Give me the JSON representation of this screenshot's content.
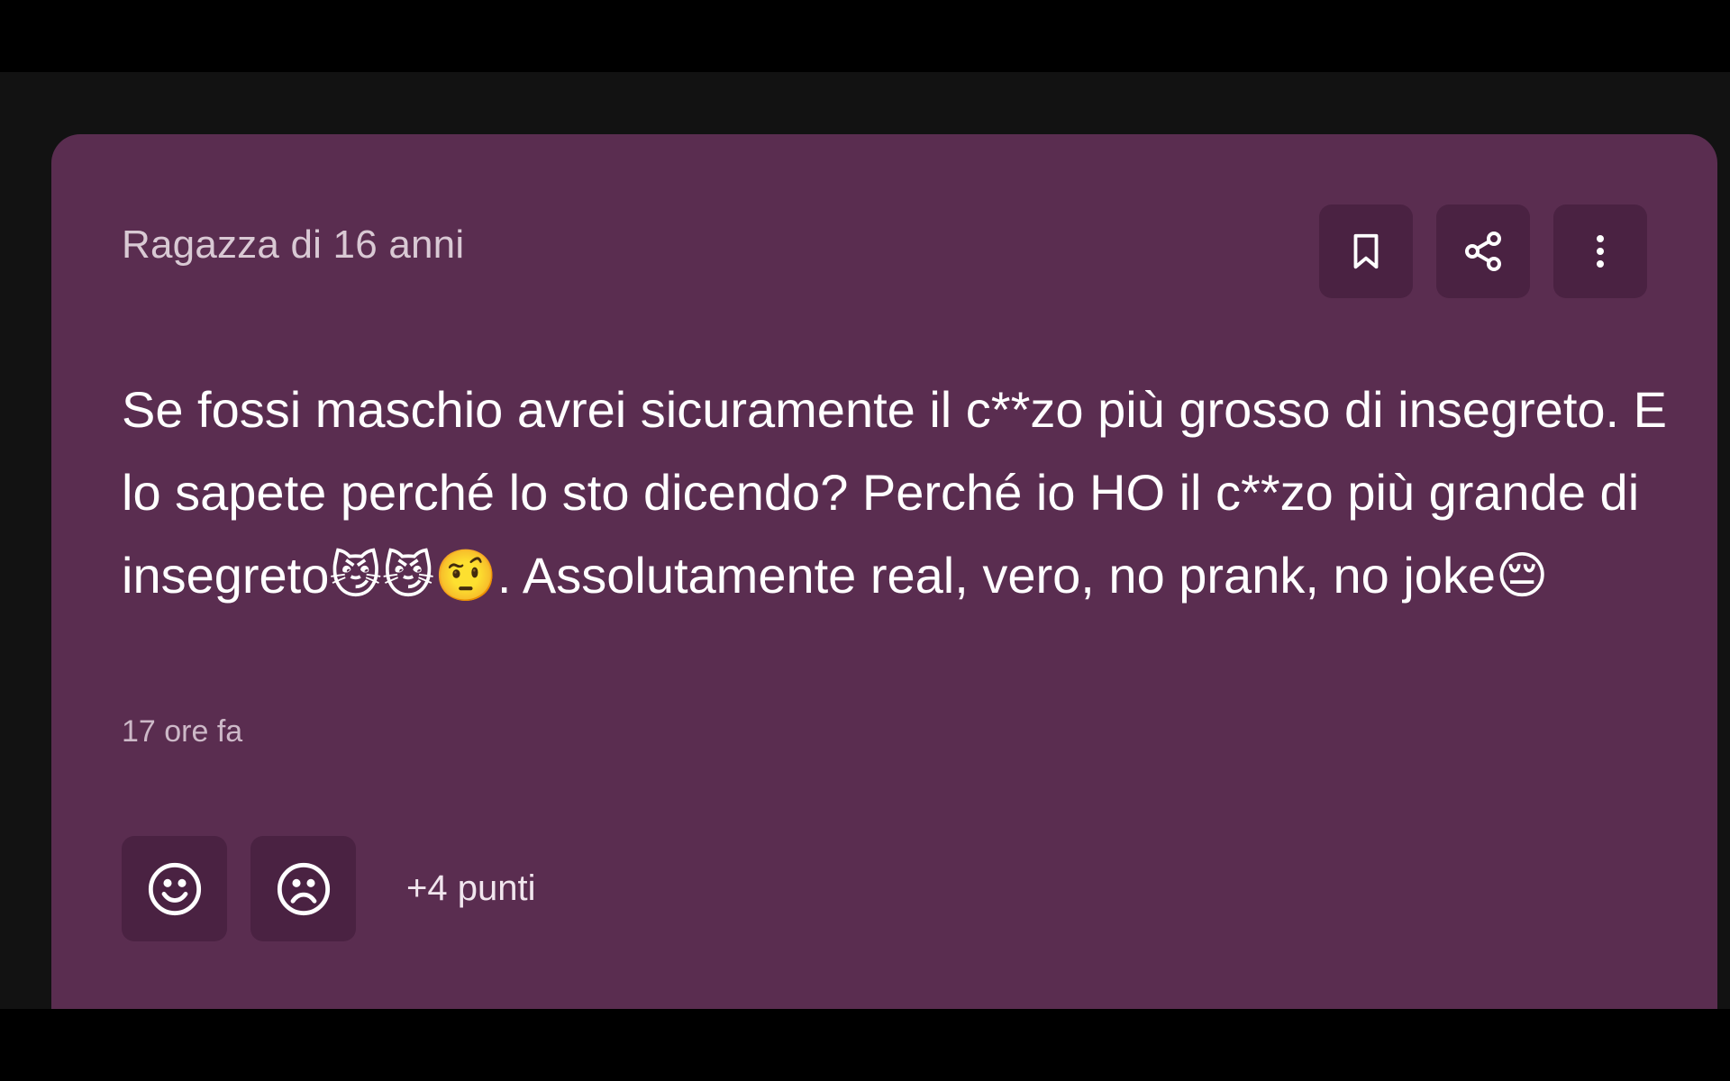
{
  "post": {
    "author_label": "Ragazza di 16 anni",
    "text": "Se fossi maschio avrei sicuramente il c**zo più grosso di insegreto. E lo sapete perché lo sto dicendo? Perché io HO il c**zo più grande di insegreto😼😼🤨. Assolutamente real, vero, no prank, no joke😔",
    "timestamp": "17 ore fa",
    "points": "+4 punti"
  },
  "icons": {
    "save": "bookmark-icon",
    "share": "share-icon",
    "more": "more-vertical-icon",
    "upvote": "smile-icon",
    "downvote": "frown-icon"
  },
  "colors": {
    "card_background": "#5a2d50",
    "button_background": "#4a2242",
    "page_background": "#121212"
  }
}
